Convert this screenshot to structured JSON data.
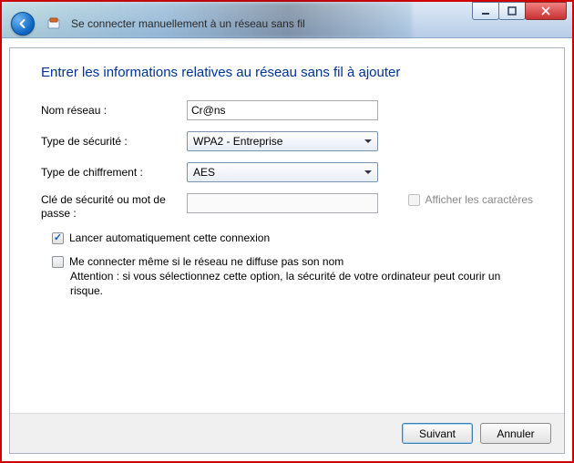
{
  "window": {
    "title": "Se connecter manuellement à un réseau sans fil"
  },
  "heading": "Entrer les informations relatives au réseau sans fil à ajouter",
  "form": {
    "network_name_label": "Nom réseau :",
    "network_name_value": "Cr@ns",
    "security_type_label": "Type de sécurité :",
    "security_type_value": "WPA2 - Entreprise",
    "encryption_type_label": "Type de chiffrement :",
    "encryption_type_value": "AES",
    "security_key_label": "Clé de sécurité ou mot de passe :",
    "security_key_value": "",
    "show_characters_label": "Afficher les caractères",
    "show_characters_checked": false,
    "show_characters_enabled": false,
    "auto_start_label": "Lancer automatiquement cette connexion",
    "auto_start_checked": true,
    "connect_hidden_label": "Me connecter même si le réseau ne diffuse pas son nom",
    "connect_hidden_checked": false,
    "connect_hidden_warning": "Attention : si vous sélectionnez cette option, la sécurité de votre ordinateur peut courir un risque."
  },
  "buttons": {
    "next": "Suivant",
    "cancel": "Annuler"
  },
  "colors": {
    "heading": "#003399",
    "frame_border": "#d00000"
  }
}
